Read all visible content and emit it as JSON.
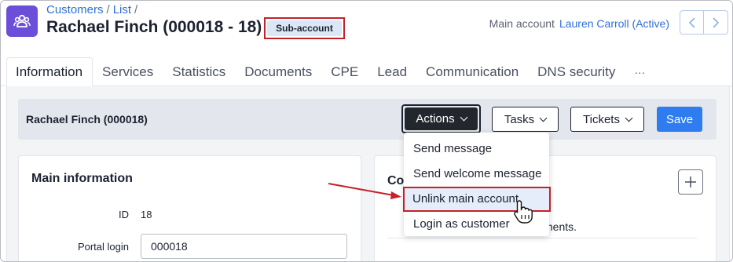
{
  "header": {
    "breadcrumb": [
      "Customers",
      "List"
    ],
    "breadcrumb_sep": "/",
    "title": "Rachael Finch (000018 - 18)",
    "badge": "Sub-account",
    "main_account_label": "Main account",
    "main_account_value": "Lauren Carroll (Active)",
    "logo_icon": "users-group-icon",
    "accent": "#6b4fd8"
  },
  "tabs": [
    {
      "label": "Information",
      "active": true
    },
    {
      "label": "Services"
    },
    {
      "label": "Statistics"
    },
    {
      "label": "Documents"
    },
    {
      "label": "CPE"
    },
    {
      "label": "Lead"
    },
    {
      "label": "Communication"
    },
    {
      "label": "DNS security"
    },
    {
      "label": "···"
    }
  ],
  "toolbar": {
    "title": "Rachael Finch (000018)",
    "actions_label": "Actions",
    "tasks_label": "Tasks",
    "tickets_label": "Tickets",
    "save_label": "Save"
  },
  "actions_menu": {
    "items": [
      {
        "label": "Send message"
      },
      {
        "label": "Send welcome message"
      },
      {
        "label": "Unlink main account",
        "highlighted": true
      },
      {
        "label": "Login as customer"
      }
    ]
  },
  "main_info": {
    "title": "Main information",
    "id_label": "ID",
    "id_value": "18",
    "portal_login_label": "Portal login",
    "portal_login_value": "000018"
  },
  "right_card": {
    "title": "Co",
    "text": "ments.",
    "add_icon": "plus-icon"
  },
  "colors": {
    "primary": "#2f7cf0",
    "highlight_border": "#c4222a",
    "dark_button": "#23262d"
  }
}
